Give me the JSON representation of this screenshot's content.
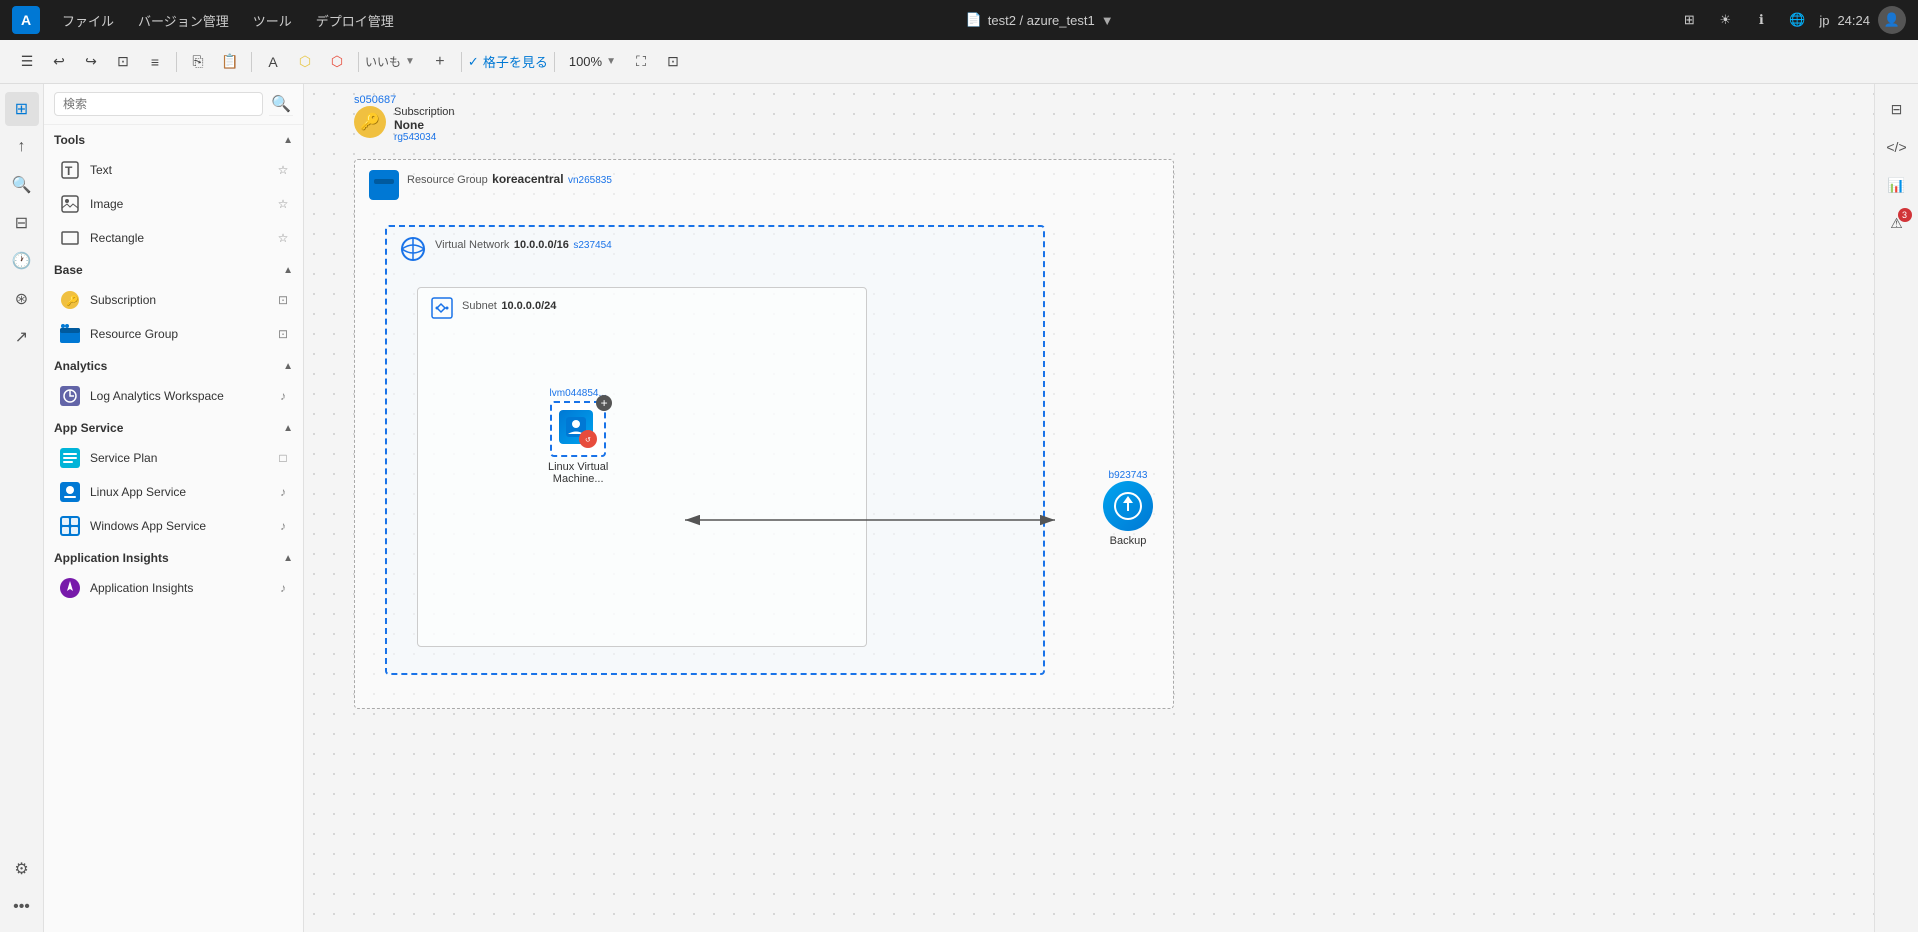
{
  "menubar": {
    "logo": "A",
    "menus": [
      "ファイル",
      "バージョン管理",
      "ツール",
      "デプロイ管理"
    ],
    "file_path": "test2 / azure_test1",
    "time": "24:24",
    "lang": "jp"
  },
  "toolbar": {
    "grid_label": "格子を見る",
    "zoom_value": "100%",
    "branch_label": "いいも"
  },
  "sidebar": {
    "search_placeholder": "検索",
    "sections": [
      {
        "name": "Tools",
        "label": "Tools",
        "items": [
          {
            "id": "text",
            "label": "Text"
          },
          {
            "id": "image",
            "label": "Image"
          },
          {
            "id": "rectangle",
            "label": "Rectangle"
          }
        ]
      },
      {
        "name": "Base",
        "label": "Base",
        "items": [
          {
            "id": "subscription",
            "label": "Subscription"
          },
          {
            "id": "resource-group",
            "label": "Resource Group"
          }
        ]
      },
      {
        "name": "Analytics",
        "label": "Analytics",
        "items": [
          {
            "id": "log-analytics",
            "label": "Log Analytics Workspace"
          }
        ]
      },
      {
        "name": "App Service",
        "label": "App Service",
        "items": [
          {
            "id": "service-plan",
            "label": "Service Plan"
          },
          {
            "id": "linux-app-service",
            "label": "Linux App Service"
          },
          {
            "id": "windows-app-service",
            "label": "Windows App Service"
          }
        ]
      },
      {
        "name": "Application Insights",
        "label": "Application Insights",
        "items": [
          {
            "id": "app-insights",
            "label": "Application Insights"
          }
        ]
      }
    ]
  },
  "diagram": {
    "subscription_badge": "s050687",
    "subscription": {
      "title": "Subscription",
      "name": "None",
      "id": "rg543034"
    },
    "resource_group": {
      "title": "Resource Group",
      "name": "koreacentral",
      "id": "vn265835"
    },
    "virtual_network": {
      "title": "Virtual Network",
      "name": "10.0.0.0/16",
      "id": "s237454"
    },
    "subnet": {
      "title": "Subnet",
      "name": "10.0.0.0/24"
    },
    "vm": {
      "id": "lvm044854...",
      "label": "Linux Virtual\nMachine..."
    },
    "backup": {
      "id": "b923743",
      "label": "Backup"
    }
  },
  "right_panel": {
    "notification_count": "3"
  }
}
